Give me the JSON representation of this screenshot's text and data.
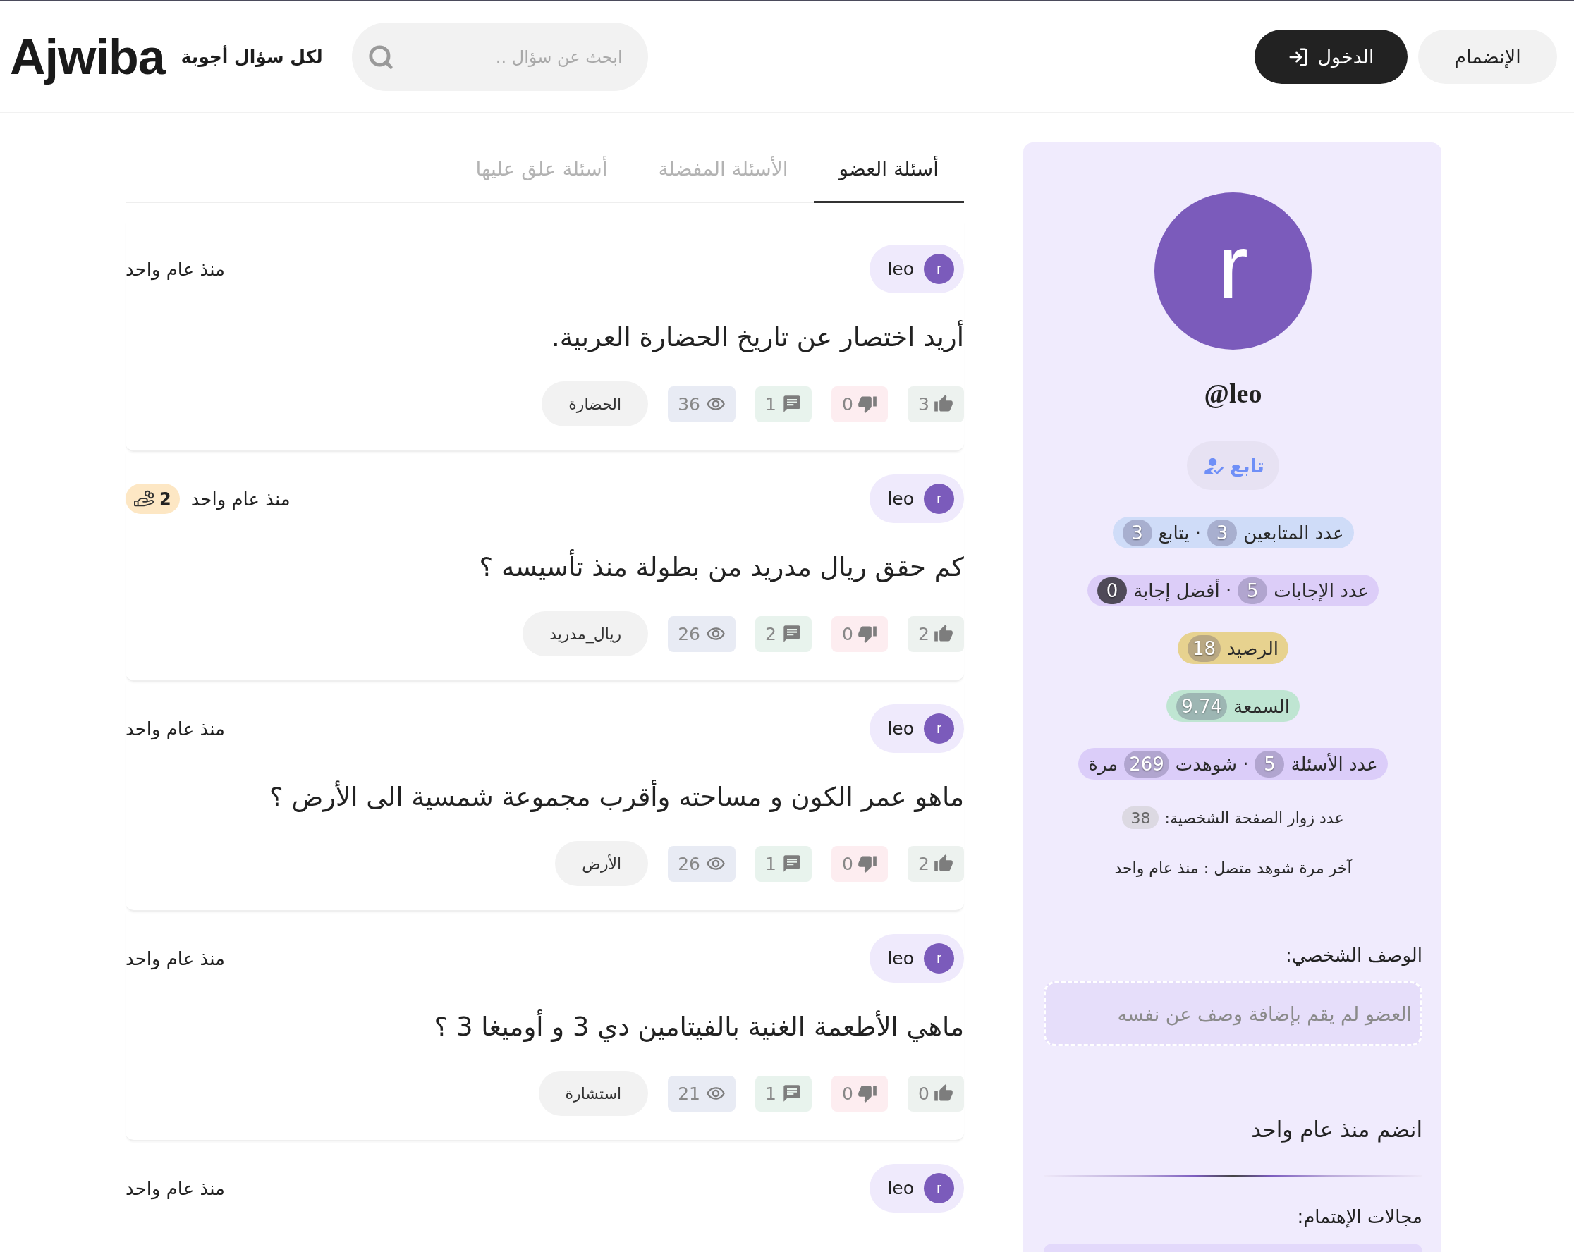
{
  "header": {
    "buttons": [
      {
        "kind": "join",
        "label": "الإنضمام"
      },
      {
        "kind": "login",
        "label": "الدخول"
      }
    ],
    "search": {
      "placeholder": "ابحث عن سؤال .."
    },
    "tagline": "لكل سؤال أجوبة",
    "logo": "Ajwiba"
  },
  "profile": {
    "avatar_initial": "r",
    "username": "@leo",
    "follow_label": "تابع",
    "stat_pills": [
      {
        "color": "#cfdcf8",
        "segments": [
          {
            "kind": "text",
            "text": "عدد المتابعين"
          },
          {
            "kind": "count",
            "text": "3"
          },
          {
            "kind": "text",
            "text": "· يتابع"
          },
          {
            "kind": "count",
            "text": "3"
          }
        ]
      },
      {
        "color": "#dccdf8",
        "segments": [
          {
            "kind": "text",
            "text": "عدد الإجابات"
          },
          {
            "kind": "count",
            "text": "5"
          },
          {
            "kind": "text",
            "text": "· أفضل إجابة"
          },
          {
            "kind": "strongcount",
            "text": "0"
          }
        ]
      },
      {
        "color": "#e7d28f",
        "segments": [
          {
            "kind": "text",
            "text": "الرصيد"
          },
          {
            "kind": "count",
            "text": "18"
          }
        ]
      },
      {
        "color": "#bfe5d2",
        "segments": [
          {
            "kind": "text",
            "text": "السمعة"
          },
          {
            "kind": "count",
            "text": "9.74"
          }
        ]
      },
      {
        "color": "#dbcdf9",
        "segments": [
          {
            "kind": "text",
            "text": "عدد الأسئلة"
          },
          {
            "kind": "count",
            "text": "5"
          },
          {
            "kind": "text",
            "text": "· شوهدت"
          },
          {
            "kind": "count",
            "text": "269"
          },
          {
            "kind": "text",
            "text": "مرة"
          }
        ]
      }
    ],
    "visitors": {
      "label": "عدد زوار الصفحة الشخصية:",
      "count": "38"
    },
    "last_seen": "آخر مرة شوهد متصل : منذ عام واحد",
    "bio_heading": "الوصف الشخصي:",
    "bio_text": "العضو لم يقم بإضافة وصف عن نفسه",
    "joined": "انضم منذ عام واحد",
    "interests_heading": "مجالات الإهتمام:"
  },
  "tabs": [
    {
      "label": "أسئلة العضو",
      "selected": true
    },
    {
      "label": "الأسئلة المفضلة",
      "selected": false
    },
    {
      "label": "أسئلة علق عليها",
      "selected": false
    }
  ],
  "questions": [
    {
      "author": {
        "initial": "r",
        "name": "leo"
      },
      "time": "منذ عام واحد",
      "title": "أريد اختصار عن تاريخ الحضارة العربية.",
      "stats": [
        {
          "kind": "likes",
          "count": "3"
        },
        {
          "kind": "dislikes",
          "count": "0"
        },
        {
          "kind": "comments",
          "count": "1"
        },
        {
          "kind": "views",
          "count": "36"
        }
      ],
      "tag": "الحضارة"
    },
    {
      "author": {
        "initial": "r",
        "name": "leo"
      },
      "time": "منذ عام واحد",
      "bounty": "2",
      "title": "كم حقق ريال مدريد من بطولة منذ تأسيسه ؟",
      "stats": [
        {
          "kind": "likes",
          "count": "2"
        },
        {
          "kind": "dislikes",
          "count": "0"
        },
        {
          "kind": "comments",
          "count": "2"
        },
        {
          "kind": "views",
          "count": "26"
        }
      ],
      "tag": "ريال_مدريد"
    },
    {
      "author": {
        "initial": "r",
        "name": "leo"
      },
      "time": "منذ عام واحد",
      "title": "ماهو عمر الكون و مساحته وأقرب مجموعة شمسية الى الأرض ؟",
      "stats": [
        {
          "kind": "likes",
          "count": "2"
        },
        {
          "kind": "dislikes",
          "count": "0"
        },
        {
          "kind": "comments",
          "count": "1"
        },
        {
          "kind": "views",
          "count": "26"
        }
      ],
      "tag": "الأرض"
    },
    {
      "author": {
        "initial": "r",
        "name": "leo"
      },
      "time": "منذ عام واحد",
      "title": "ماهي الأطعمة الغنية بالفيتامين دي 3 و أوميغا 3 ؟",
      "stats": [
        {
          "kind": "likes",
          "count": "0"
        },
        {
          "kind": "dislikes",
          "count": "0"
        },
        {
          "kind": "comments",
          "count": "1"
        },
        {
          "kind": "views",
          "count": "21"
        }
      ],
      "tag": "استشارة"
    },
    {
      "author": {
        "initial": "r",
        "name": "leo"
      },
      "time": "منذ عام واحد"
    }
  ]
}
